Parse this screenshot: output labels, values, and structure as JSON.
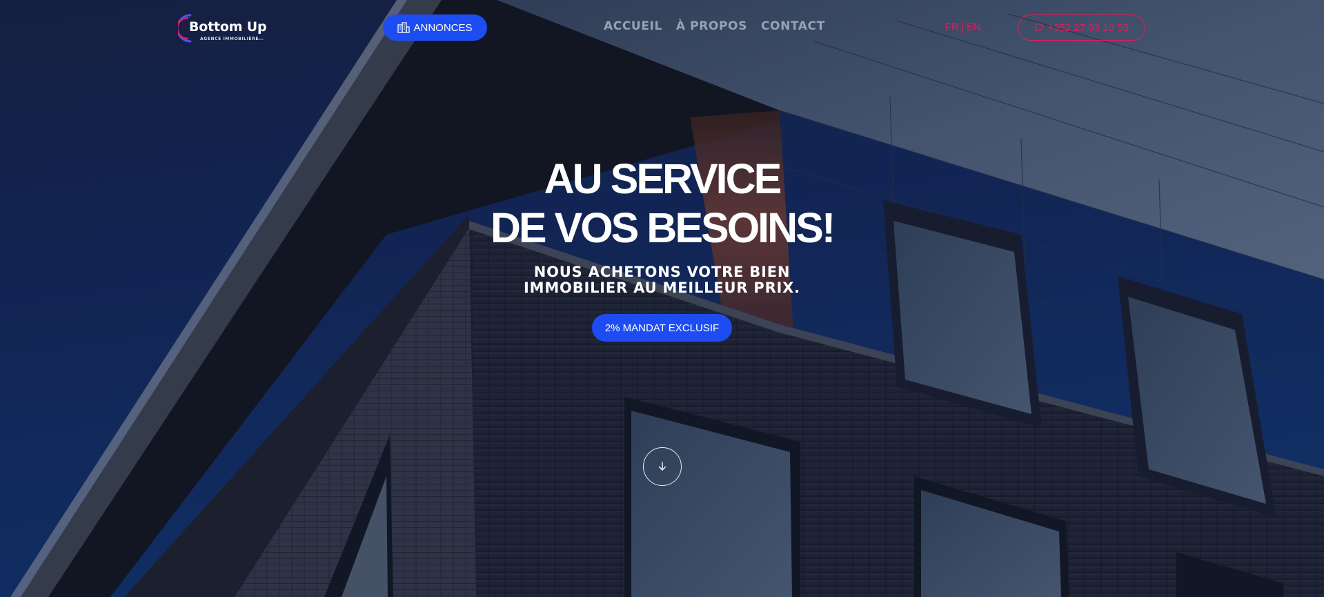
{
  "header": {
    "logo": {
      "name": "Bottom Up",
      "tagline": "AGENCE IMMOBILIÈRE"
    },
    "annonces_button": {
      "label": "ANNONCES",
      "icon": "buildings-icon"
    },
    "nav": [
      {
        "label": "ACCUEIL"
      },
      {
        "label": "À PROPOS"
      },
      {
        "label": "CONTACT"
      }
    ],
    "language": {
      "fr": "FR",
      "en": "EN"
    },
    "phone_button": {
      "label": "+352 27 93 10 53",
      "icon": "chat-icon"
    }
  },
  "hero": {
    "headline_line1": "AU SERVICE",
    "headline_line2": "DE VOS BESOINS!",
    "subline_line1": "NOUS ACHETONS VOTRE BIEN",
    "subline_line2": "IMMOBILIER AU MEILLEUR PRIX.",
    "cta_label": "2% MANDAT EXCLUSIF",
    "scroll_icon": "arrow-down-icon"
  },
  "colors": {
    "accent_blue": "#1d4df2",
    "accent_pink": "#e11d59",
    "nav_grey": "#9aa1b3",
    "sky": "#15366f"
  }
}
